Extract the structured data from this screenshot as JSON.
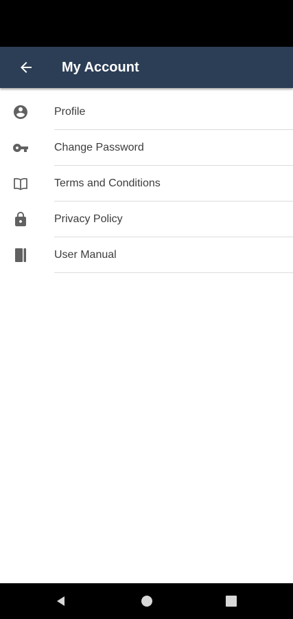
{
  "header": {
    "title": "My Account",
    "back_icon": "arrow-back-icon",
    "background": "#2c3e55"
  },
  "menu": {
    "items": [
      {
        "label": "Profile",
        "icon": "account-circle-icon"
      },
      {
        "label": "Change Password",
        "icon": "key-icon"
      },
      {
        "label": "Terms and Conditions",
        "icon": "open-book-icon"
      },
      {
        "label": "Privacy Policy",
        "icon": "lock-icon"
      },
      {
        "label": "User Manual",
        "icon": "manual-book-icon"
      }
    ],
    "icon_color": "#616161"
  },
  "system_nav": {
    "back_icon": "nav-back-triangle-icon",
    "home_icon": "nav-home-circle-icon",
    "recents_icon": "nav-recents-square-icon"
  }
}
